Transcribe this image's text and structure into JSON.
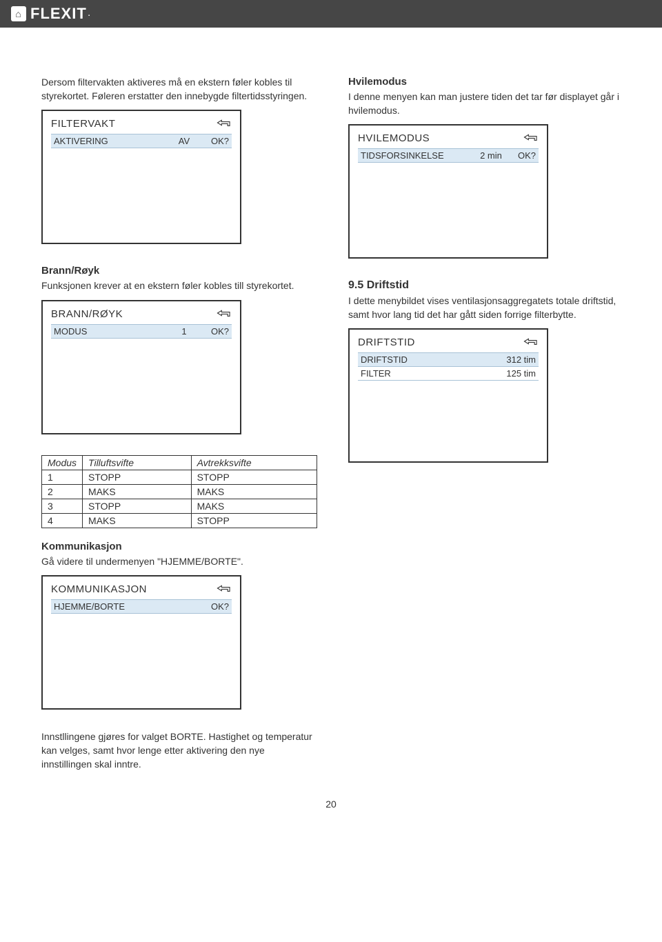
{
  "header": {
    "brand": "FLEXIT",
    "icon": "⌂"
  },
  "intro_left": "Dersom filtervakten aktiveres må en ekstern føler kobles til styrekortet. Føleren erstatter den innebygde filtertidsstyringen.",
  "panel_filtervakt": {
    "title": "FILTERVAKT",
    "row": {
      "label": "AKTIVERING",
      "value": "AV",
      "action": "OK?"
    }
  },
  "brann": {
    "heading": "Brann/Røyk",
    "text": "Funksjonen krever at en ekstern føler kobles till styrekortet.",
    "panel": {
      "title": "BRANN/RØYK",
      "row": {
        "label": "MODUS",
        "value": "1",
        "action": "OK?"
      }
    }
  },
  "modus_table": {
    "headers": [
      "Modus",
      "Tilluftsvifte",
      "Avtrekksvifte"
    ],
    "rows": [
      [
        "1",
        "STOPP",
        "STOPP"
      ],
      [
        "2",
        "MAKS",
        "MAKS"
      ],
      [
        "3",
        "STOPP",
        "MAKS"
      ],
      [
        "4",
        "MAKS",
        "STOPP"
      ]
    ]
  },
  "komm": {
    "heading": "Kommunikasjon",
    "text": "Gå videre til undermenyen \"HJEMME/BORTE\".",
    "panel": {
      "title": "KOMMUNIKASJON",
      "row": {
        "label": "HJEMME/BORTE",
        "action": "OK?"
      }
    },
    "footer": "Innstllingene gjøres for valget BORTE. Hastighet og temperatur kan velges, samt hvor lenge etter aktivering den nye innstillingen skal inntre."
  },
  "hvile": {
    "heading": "Hvilemodus",
    "text": "I denne menyen kan man justere tiden det tar før displayet går i hvilemodus.",
    "panel": {
      "title": "HVILEMODUS",
      "row": {
        "label": "TIDSFORSINKELSE",
        "value": "2 min",
        "action": "OK?"
      }
    }
  },
  "drift": {
    "heading": "9.5  Driftstid",
    "text": "I dette menybildet vises ventilasjonsaggregatets totale driftstid, samt hvor lang tid det har gått siden forrige filterbytte.",
    "panel": {
      "title": "DRIFTSTID",
      "rows": [
        {
          "label": "DRIFTSTID",
          "value": "312 tim"
        },
        {
          "label": "FILTER",
          "value": "125 tim"
        }
      ]
    }
  },
  "page_number": "20"
}
